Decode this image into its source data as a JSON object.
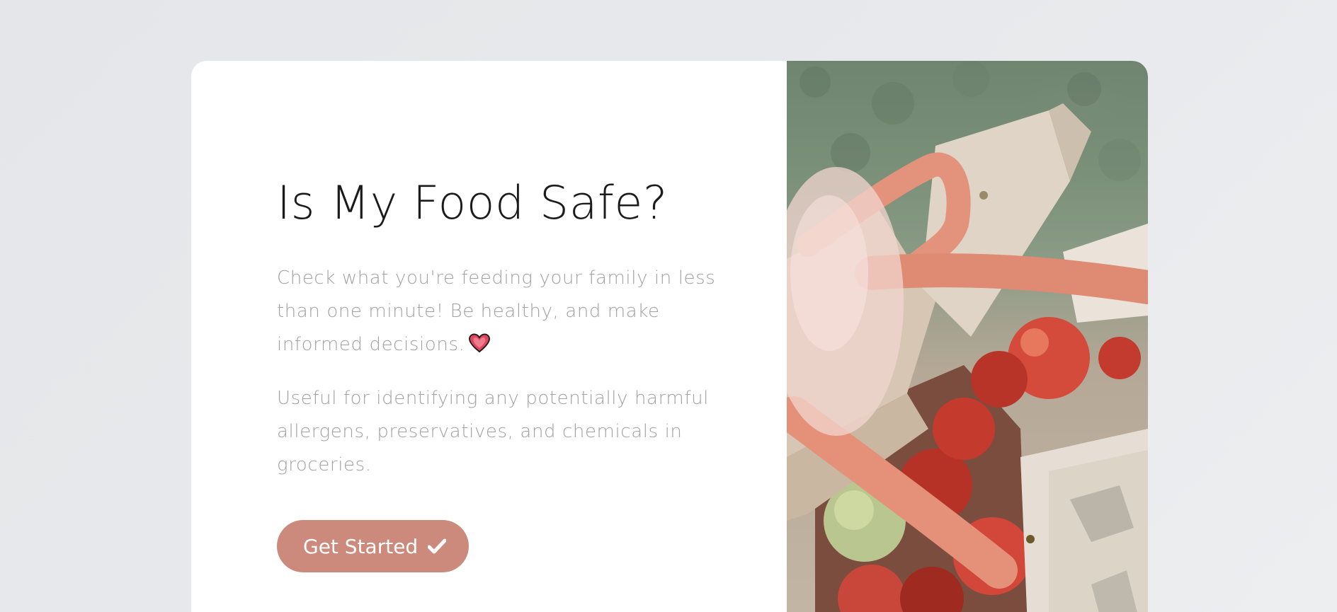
{
  "hero": {
    "title": "Is My Food Safe?",
    "paragraph_1": "Check what you're feeding your family in less than one minute! Be healthy, and make informed decisions.",
    "paragraph_2": "Useful for identifying any potentially harmful allergens, preservatives, and chemicals in groceries.",
    "heart_icon": "heart-emoji",
    "cta_label": "Get Started",
    "cta_icon": "checkmark-icon"
  },
  "colors": {
    "accent": "#cc8a7c",
    "title_text": "#1b1b1b",
    "body_text": "#a2a2a2",
    "background": "#e7e9ec",
    "card": "#ffffff"
  },
  "image": {
    "subject": "tote bag filled with red apples on grass"
  }
}
